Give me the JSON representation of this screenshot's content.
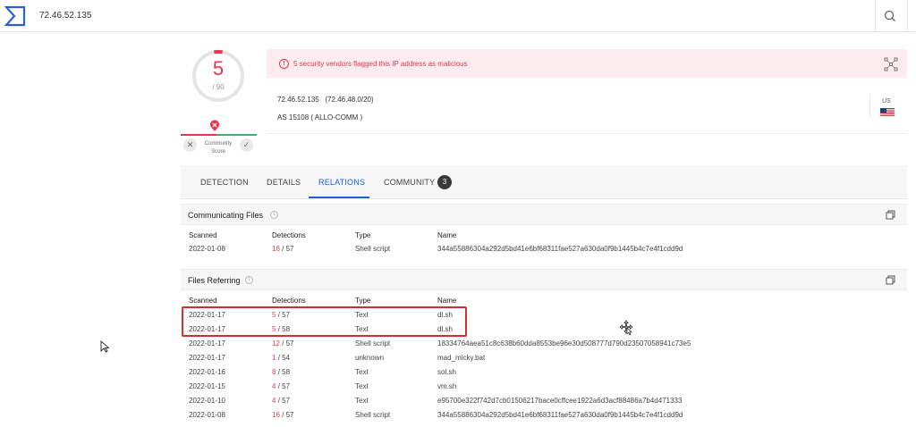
{
  "search": {
    "value": "72.46.52.135"
  },
  "score": {
    "value": "5",
    "total": "/ 90"
  },
  "community": {
    "label": "Community\nScore",
    "label_line1": "Community",
    "label_line2": "Score"
  },
  "alert": {
    "text": "5 security vendors flagged this IP address as malicious",
    "icon": "!"
  },
  "ip_info": {
    "ip": "72.46.52.135",
    "network": "(72.46.48.0/20)",
    "as": "AS 15108 ( ALLO-COMM )",
    "country_code": "US"
  },
  "tabs": [
    {
      "label": "DETECTION"
    },
    {
      "label": "DETAILS"
    },
    {
      "label": "RELATIONS"
    },
    {
      "label": "COMMUNITY",
      "badge": "3"
    }
  ],
  "communicating_files": {
    "title": "Communicating Files",
    "columns": [
      "Scanned",
      "Detections",
      "Type",
      "Name"
    ],
    "rows": [
      {
        "scanned": "2022-01-08",
        "det": "16",
        "total": "/ 57",
        "type": "Shell script",
        "name": "344a55886304a292d5bd41e6bf68311fae527a630da0f9b1445b4c7e4f1cdd9d"
      }
    ]
  },
  "files_referring": {
    "title": "Files Referring",
    "columns": [
      "Scanned",
      "Detections",
      "Type",
      "Name"
    ],
    "rows": [
      {
        "scanned": "2022-01-17",
        "det": "5",
        "total": "/ 57",
        "type": "Text",
        "name": "dl.sh"
      },
      {
        "scanned": "2022-01-17",
        "det": "5",
        "total": "/ 58",
        "type": "Text",
        "name": "dl.sh"
      },
      {
        "scanned": "2022-01-17",
        "det": "12",
        "total": "/ 57",
        "type": "Shell script",
        "name": "18334764aea51c8c638b60dda8553be96e30d508777d790d23507058941c73e5"
      },
      {
        "scanned": "2022-01-17",
        "det": "1",
        "total": "/ 54",
        "type": "unknown",
        "name": "mad_micky.bat"
      },
      {
        "scanned": "2022-01-16",
        "det": "8",
        "total": "/ 58",
        "type": "Text",
        "name": "sol.sh"
      },
      {
        "scanned": "2022-01-15",
        "det": "4",
        "total": "/ 57",
        "type": "Text",
        "name": "vm.sh"
      },
      {
        "scanned": "2022-01-10",
        "det": "4",
        "total": "/ 57",
        "type": "Text",
        "name": "e95700e322f742d7cb01506217bace0cffcee1922a6d3acf88486a7b4d471333"
      },
      {
        "scanned": "2022-01-08",
        "det": "16",
        "total": "/ 57",
        "type": "Shell script",
        "name": "344a55886304a292d5bd41e6bf68311fae527a630da0f9b1445b4c7e4f1cdd9d"
      }
    ]
  },
  "colors": {
    "accent": "#1a63d6",
    "malicious": "#e5384e",
    "harmless": "#3cb371",
    "highlight": "#d32f2f"
  },
  "icons": [
    "logo-icon",
    "search-icon",
    "alert-icon",
    "graph-icon",
    "flag-us-icon",
    "info-icon",
    "copy-icon",
    "thumbs-down-icon",
    "thumbs-up-icon",
    "cursor-icon",
    "move-cursor-icon"
  ]
}
